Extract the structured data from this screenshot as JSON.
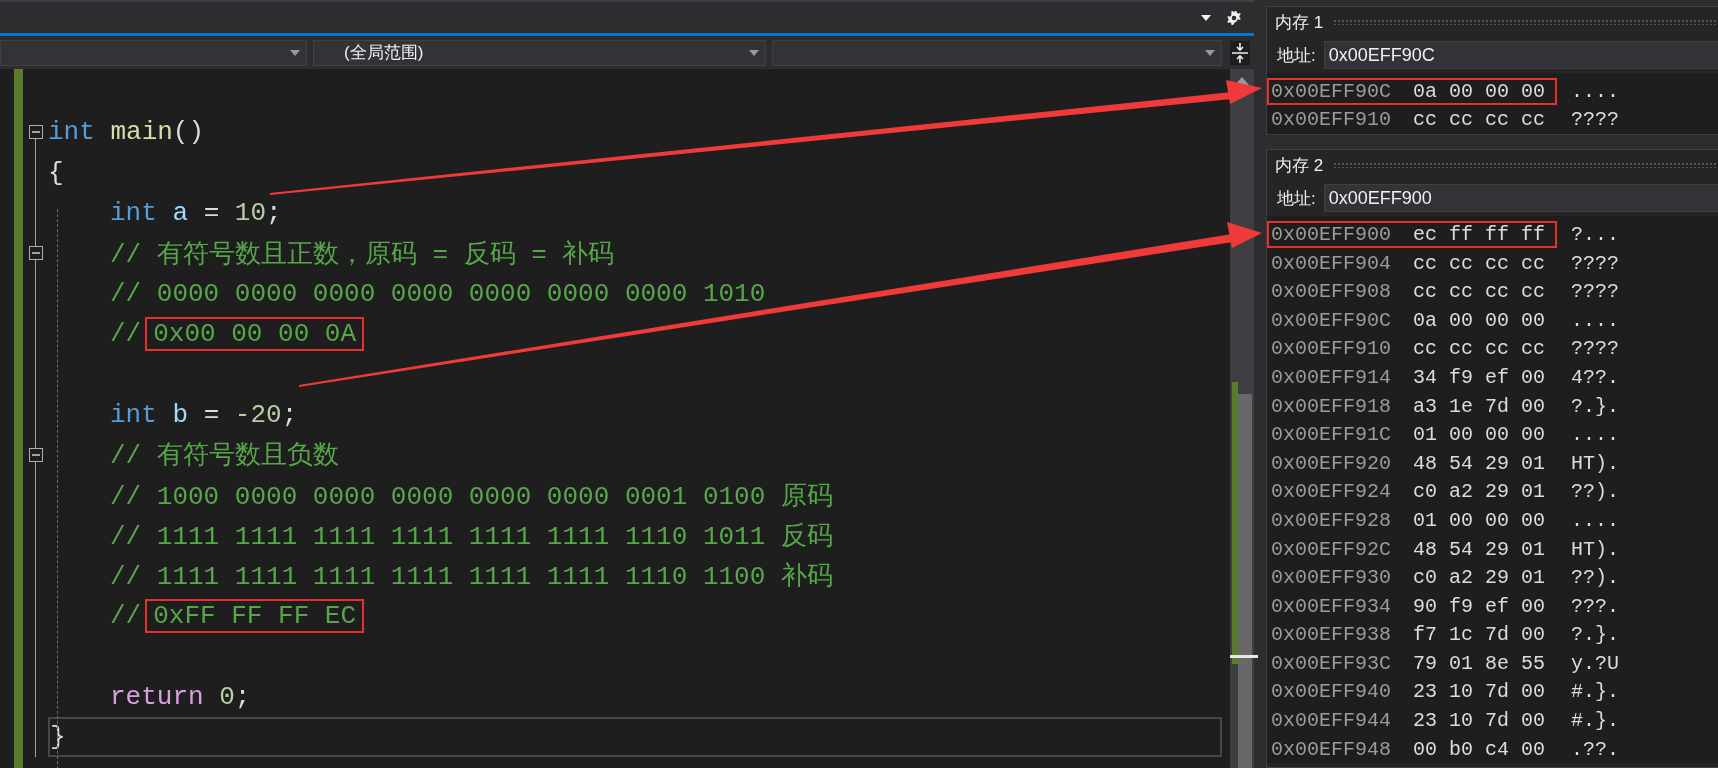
{
  "navigation_bar": {
    "scope_dropdown": "(全局范围)"
  },
  "editor": {
    "lines": [
      {
        "fold": false,
        "current": false
      },
      {
        "fold": true,
        "current": false,
        "segments": [
          {
            "boxed": false,
            "tokens": [
              {
                "kind": "keyword",
                "text": "int "
              },
              {
                "kind": "function",
                "text": "main"
              },
              {
                "kind": "plain",
                "text": "()"
              }
            ]
          }
        ]
      },
      {
        "fold": false,
        "current": false,
        "segments": [
          {
            "boxed": false,
            "tokens": [
              {
                "kind": "plain",
                "text": "{"
              }
            ]
          }
        ],
        "children": [
          {
            "fold": false,
            "current": false,
            "segments": [
              {
                "boxed": false,
                "tokens": [
                  {
                    "kind": "keyword",
                    "text": "int "
                  },
                  {
                    "kind": "variable",
                    "text": "a"
                  },
                  {
                    "kind": "plain",
                    "text": " = "
                  },
                  {
                    "kind": "number",
                    "text": "10"
                  },
                  {
                    "kind": "plain",
                    "text": ";"
                  }
                ]
              }
            ]
          },
          {
            "fold": true,
            "current": false,
            "segments": [
              {
                "boxed": false,
                "tokens": [
                  {
                    "kind": "comment",
                    "text": "// 有符号数且正数，原码 = 反码 = 补码"
                  }
                ]
              }
            ]
          },
          {
            "fold": false,
            "current": false,
            "segments": [
              {
                "boxed": false,
                "tokens": [
                  {
                    "kind": "comment",
                    "text": "// 0000 0000 0000 0000 0000 0000 0000 1010"
                  }
                ]
              }
            ]
          },
          {
            "fold": false,
            "current": false,
            "segments": [
              {
                "boxed": false,
                "tokens": [
                  {
                    "kind": "comment",
                    "text": "//"
                  }
                ]
              },
              {
                "boxed": true,
                "tokens": [
                  {
                    "kind": "comment",
                    "text": "0x00 00 00 0A"
                  }
                ]
              }
            ]
          },
          {
            "fold": false,
            "current": false
          },
          {
            "fold": false,
            "current": false,
            "segments": [
              {
                "boxed": false,
                "tokens": [
                  {
                    "kind": "keyword",
                    "text": "int "
                  },
                  {
                    "kind": "variable",
                    "text": "b"
                  },
                  {
                    "kind": "plain",
                    "text": " = "
                  },
                  {
                    "kind": "number",
                    "text": "-20"
                  },
                  {
                    "kind": "plain",
                    "text": ";"
                  }
                ]
              }
            ]
          },
          {
            "fold": true,
            "current": false,
            "segments": [
              {
                "boxed": false,
                "tokens": [
                  {
                    "kind": "comment",
                    "text": "// 有符号数且负数"
                  }
                ]
              }
            ]
          },
          {
            "fold": false,
            "current": false,
            "segments": [
              {
                "boxed": false,
                "tokens": [
                  {
                    "kind": "comment",
                    "text": "// 1000 0000 0000 0000 0000 0000 0001 0100 原码"
                  }
                ]
              }
            ]
          },
          {
            "fold": false,
            "current": false,
            "segments": [
              {
                "boxed": false,
                "tokens": [
                  {
                    "kind": "comment",
                    "text": "// 1111 1111 1111 1111 1111 1111 1110 1011 反码"
                  }
                ]
              }
            ]
          },
          {
            "fold": false,
            "current": false,
            "segments": [
              {
                "boxed": false,
                "tokens": [
                  {
                    "kind": "comment",
                    "text": "// 1111 1111 1111 1111 1111 1111 1110 1100 补码"
                  }
                ]
              }
            ]
          },
          {
            "fold": false,
            "current": false,
            "segments": [
              {
                "boxed": false,
                "tokens": [
                  {
                    "kind": "comment",
                    "text": "//"
                  }
                ]
              },
              {
                "boxed": true,
                "tokens": [
                  {
                    "kind": "comment",
                    "text": "0xFF FF FF EC"
                  }
                ]
              }
            ]
          },
          {
            "fold": false,
            "current": false
          },
          {
            "fold": false,
            "current": false,
            "segments": [
              {
                "boxed": false,
                "tokens": [
                  {
                    "kind": "control",
                    "text": "return "
                  },
                  {
                    "kind": "number",
                    "text": "0"
                  },
                  {
                    "kind": "plain",
                    "text": ";"
                  }
                ]
              }
            ]
          }
        ]
      },
      {
        "fold": false,
        "current": true,
        "segments": [
          {
            "boxed": false,
            "tokens": [
              {
                "kind": "plain",
                "text": "}"
              }
            ]
          }
        ]
      }
    ]
  },
  "memory_panels": [
    {
      "title": "内存 1",
      "address_label": "地址:",
      "address": "0x00EFF90C",
      "rows": [
        {
          "address": "0x00EFF90C",
          "bytes": "0a 00 00 00",
          "ascii": "....",
          "boxed": true
        },
        {
          "address": "0x00EFF910",
          "bytes": "cc cc cc cc",
          "ascii": "????",
          "boxed": false
        }
      ]
    },
    {
      "title": "内存 2",
      "address_label": "地址:",
      "address": "0x00EFF900",
      "rows": [
        {
          "address": "0x00EFF900",
          "bytes": "ec ff ff ff",
          "ascii": "?...",
          "boxed": true
        },
        {
          "address": "0x00EFF904",
          "bytes": "cc cc cc cc",
          "ascii": "????",
          "boxed": false
        },
        {
          "address": "0x00EFF908",
          "bytes": "cc cc cc cc",
          "ascii": "????",
          "boxed": false
        },
        {
          "address": "0x00EFF90C",
          "bytes": "0a 00 00 00",
          "ascii": "....",
          "boxed": false
        },
        {
          "address": "0x00EFF910",
          "bytes": "cc cc cc cc",
          "ascii": "????",
          "boxed": false
        },
        {
          "address": "0x00EFF914",
          "bytes": "34 f9 ef 00",
          "ascii": "4??.",
          "boxed": false
        },
        {
          "address": "0x00EFF918",
          "bytes": "a3 1e 7d 00",
          "ascii": "?.}.",
          "boxed": false
        },
        {
          "address": "0x00EFF91C",
          "bytes": "01 00 00 00",
          "ascii": "....",
          "boxed": false
        },
        {
          "address": "0x00EFF920",
          "bytes": "48 54 29 01",
          "ascii": "HT).",
          "boxed": false
        },
        {
          "address": "0x00EFF924",
          "bytes": "c0 a2 29 01",
          "ascii": "??).",
          "boxed": false
        },
        {
          "address": "0x00EFF928",
          "bytes": "01 00 00 00",
          "ascii": "....",
          "boxed": false
        },
        {
          "address": "0x00EFF92C",
          "bytes": "48 54 29 01",
          "ascii": "HT).",
          "boxed": false
        },
        {
          "address": "0x00EFF930",
          "bytes": "c0 a2 29 01",
          "ascii": "??).",
          "boxed": false
        },
        {
          "address": "0x00EFF934",
          "bytes": "90 f9 ef 00",
          "ascii": "???.",
          "boxed": false
        },
        {
          "address": "0x00EFF938",
          "bytes": "f7 1c 7d 00",
          "ascii": "?.}.",
          "boxed": false
        },
        {
          "address": "0x00EFF93C",
          "bytes": "79 01 8e 55",
          "ascii": "y.?U",
          "boxed": false
        },
        {
          "address": "0x00EFF940",
          "bytes": "23 10 7d 00",
          "ascii": "#.}.",
          "boxed": false
        },
        {
          "address": "0x00EFF944",
          "bytes": "23 10 7d 00",
          "ascii": "#.}.",
          "boxed": false
        },
        {
          "address": "0x00EFF948",
          "bytes": "00 b0 c4 00",
          "ascii": ".??.",
          "boxed": false
        }
      ]
    }
  ]
}
